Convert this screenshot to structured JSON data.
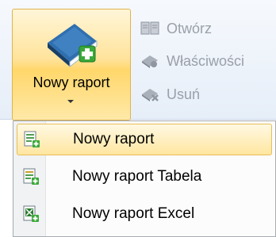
{
  "ribbon": {
    "new_report_label": "Nowy raport",
    "actions": [
      {
        "label": "Otwórz",
        "icon": "book-icon"
      },
      {
        "label": "Właściwości",
        "icon": "properties-icon"
      },
      {
        "label": "Usuń",
        "icon": "delete-icon"
      }
    ]
  },
  "menu": {
    "items": [
      {
        "label": "Nowy raport",
        "icon": "new-report-icon",
        "highlighted": true
      },
      {
        "label": "Nowy raport Tabela",
        "icon": "new-report-table-icon"
      },
      {
        "label": "Nowy raport Excel",
        "icon": "new-report-excel-icon"
      }
    ]
  },
  "colors": {
    "highlight_border": "#e8be58",
    "highlight_fill": "#ffe6a0",
    "disabled_text": "#9aa0a8",
    "book_blue": "#1f5f9f",
    "plus_green": "#3aa83a"
  }
}
